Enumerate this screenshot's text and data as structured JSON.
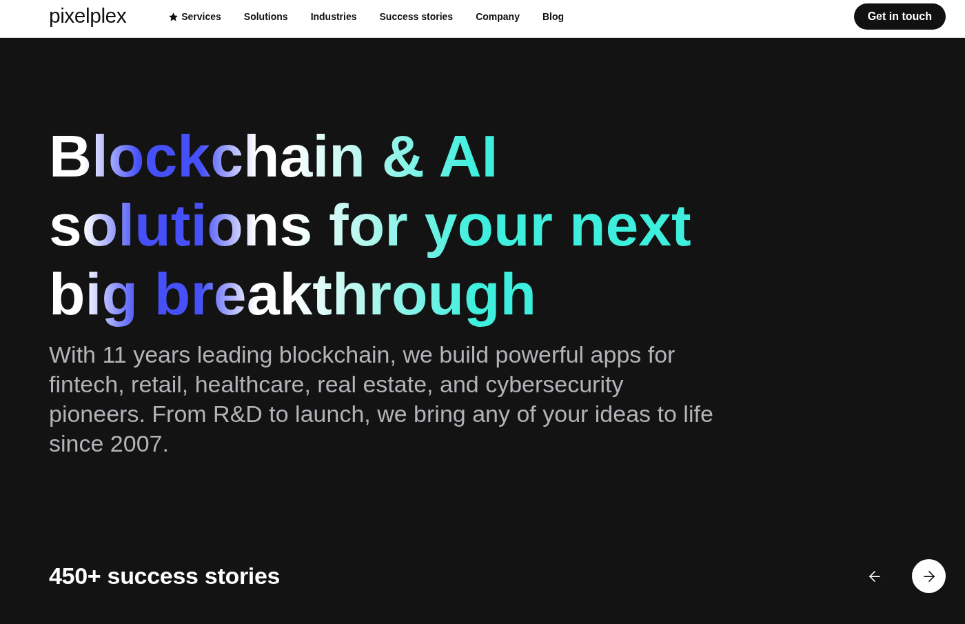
{
  "nav": {
    "logo": "pixelplex",
    "items": [
      {
        "label": "Services",
        "starred": true
      },
      {
        "label": "Solutions",
        "starred": false
      },
      {
        "label": "Industries",
        "starred": false
      },
      {
        "label": "Success stories",
        "starred": false
      },
      {
        "label": "Company",
        "starred": false
      },
      {
        "label": "Blog",
        "starred": false
      }
    ],
    "cta_button": "Get in touch"
  },
  "hero": {
    "heading": "Blockchain & AI\nsolutions for your next\nbig breakthrough",
    "description": "With 11 years leading blockchain, we build powerful apps for\nfintech, retail, healthcare, real estate, and cybersecurity\npioneers. From R&D to launch, we bring any of your ideas to life\nsince 2007.",
    "stories_label": "450+ success stories",
    "carousel_buttons": [
      {
        "kind": "prev",
        "selected": false
      },
      {
        "kind": "next",
        "selected": true
      }
    ]
  }
}
